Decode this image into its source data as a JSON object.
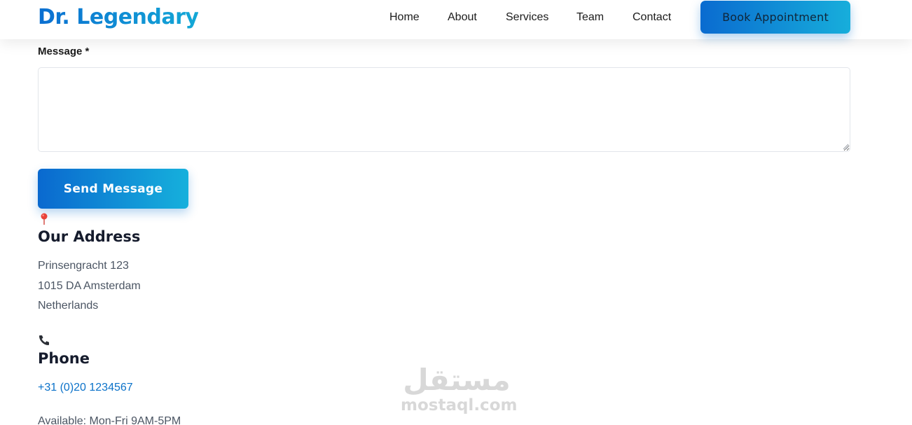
{
  "header": {
    "logo": "Dr. Legendary",
    "nav": [
      {
        "label": "Home"
      },
      {
        "label": "About"
      },
      {
        "label": "Services"
      },
      {
        "label": "Team"
      },
      {
        "label": "Contact"
      }
    ],
    "book_label": "Book Appointment"
  },
  "form": {
    "message_label": "Message *",
    "message_value": "",
    "send_label": "Send Message"
  },
  "address": {
    "icon": "map-pin-icon",
    "title": "Our Address",
    "lines": [
      "Prinsengracht 123",
      "1015 DA Amsterdam",
      "Netherlands"
    ]
  },
  "phone": {
    "icon": "phone-icon",
    "title": "Phone",
    "number": "+31 (0)20 1234567",
    "availability": "Available: Mon-Fri 9AM-5PM"
  },
  "watermark": {
    "logo_text": "مستقل",
    "site": "mostaql.com"
  },
  "colors": {
    "brand_start": "#0a6bd0",
    "brand_end": "#17aedb",
    "link": "#0b72c9",
    "pin": "#e8433a"
  }
}
